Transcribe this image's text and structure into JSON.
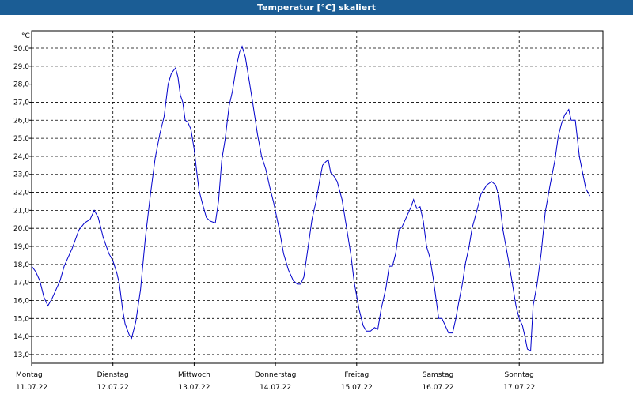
{
  "window": {
    "title": "Temperatur [°C] skaliert"
  },
  "chart_data": {
    "type": "line",
    "title": "Temperatur [°C] skaliert",
    "unit_label": "°C",
    "ylim": [
      12.5,
      31.0
    ],
    "yticks": [
      13.0,
      14.0,
      15.0,
      16.0,
      17.0,
      18.0,
      19.0,
      20.0,
      21.0,
      22.0,
      23.0,
      24.0,
      25.0,
      26.0,
      27.0,
      28.0,
      29.0,
      30.0
    ],
    "ytick_labels": [
      "13,0",
      "14,0",
      "15,0",
      "16,0",
      "17,0",
      "18,0",
      "19,0",
      "20,0",
      "21,0",
      "22,0",
      "23,0",
      "24,0",
      "25,0",
      "26,0",
      "27,0",
      "28,0",
      "29,0",
      "30,0"
    ],
    "days": [
      {
        "name": "Montag",
        "date": "11.07.22"
      },
      {
        "name": "Dienstag",
        "date": "12.07.22"
      },
      {
        "name": "Mittwoch",
        "date": "13.07.22"
      },
      {
        "name": "Donnerstag",
        "date": "14.07.22"
      },
      {
        "name": "Freitag",
        "date": "15.07.22"
      },
      {
        "name": "Samstag",
        "date": "16.07.22"
      },
      {
        "name": "Sonntag",
        "date": "17.07.22"
      }
    ],
    "x_unit": "day",
    "xlim": [
      0,
      7
    ],
    "grid": true,
    "line_color": "#0000cc",
    "series": [
      {
        "points": [
          [
            0.0,
            17.9
          ],
          [
            0.05,
            17.6
          ],
          [
            0.1,
            17.1
          ],
          [
            0.15,
            16.2
          ],
          [
            0.2,
            15.7
          ],
          [
            0.25,
            16.1
          ],
          [
            0.3,
            16.6
          ],
          [
            0.35,
            17.1
          ],
          [
            0.4,
            17.9
          ],
          [
            0.5,
            18.9
          ],
          [
            0.58,
            19.9
          ],
          [
            0.65,
            20.3
          ],
          [
            0.72,
            20.5
          ],
          [
            0.77,
            21.0
          ],
          [
            0.82,
            20.6
          ],
          [
            0.88,
            19.5
          ],
          [
            0.95,
            18.6
          ],
          [
            1.0,
            18.2
          ],
          [
            1.05,
            17.5
          ],
          [
            1.08,
            16.9
          ],
          [
            1.12,
            15.5
          ],
          [
            1.15,
            14.7
          ],
          [
            1.2,
            14.1
          ],
          [
            1.23,
            13.9
          ],
          [
            1.28,
            14.8
          ],
          [
            1.34,
            16.6
          ],
          [
            1.4,
            19.5
          ],
          [
            1.46,
            21.8
          ],
          [
            1.52,
            23.9
          ],
          [
            1.58,
            25.3
          ],
          [
            1.63,
            26.2
          ],
          [
            1.68,
            28.0
          ],
          [
            1.72,
            28.6
          ],
          [
            1.77,
            28.9
          ],
          [
            1.8,
            28.4
          ],
          [
            1.83,
            27.4
          ],
          [
            1.86,
            27.0
          ],
          [
            1.89,
            26.0
          ],
          [
            1.92,
            25.9
          ],
          [
            1.96,
            25.5
          ],
          [
            2.0,
            24.4
          ],
          [
            2.03,
            23.2
          ],
          [
            2.06,
            22.1
          ],
          [
            2.1,
            21.4
          ],
          [
            2.15,
            20.6
          ],
          [
            2.2,
            20.4
          ],
          [
            2.26,
            20.3
          ],
          [
            2.3,
            21.5
          ],
          [
            2.34,
            23.8
          ],
          [
            2.38,
            24.9
          ],
          [
            2.43,
            26.8
          ],
          [
            2.47,
            27.6
          ],
          [
            2.52,
            29.0
          ],
          [
            2.56,
            29.8
          ],
          [
            2.59,
            30.1
          ],
          [
            2.63,
            29.5
          ],
          [
            2.67,
            28.4
          ],
          [
            2.72,
            27.0
          ],
          [
            2.78,
            25.2
          ],
          [
            2.83,
            24.0
          ],
          [
            2.88,
            23.3
          ],
          [
            2.93,
            22.3
          ],
          [
            2.98,
            21.4
          ],
          [
            3.05,
            19.9
          ],
          [
            3.1,
            18.6
          ],
          [
            3.16,
            17.7
          ],
          [
            3.22,
            17.1
          ],
          [
            3.27,
            16.9
          ],
          [
            3.31,
            16.9
          ],
          [
            3.35,
            17.3
          ],
          [
            3.4,
            18.9
          ],
          [
            3.45,
            20.5
          ],
          [
            3.5,
            21.5
          ],
          [
            3.55,
            22.8
          ],
          [
            3.58,
            23.5
          ],
          [
            3.62,
            23.7
          ],
          [
            3.65,
            23.8
          ],
          [
            3.68,
            23.1
          ],
          [
            3.72,
            22.9
          ],
          [
            3.76,
            22.6
          ],
          [
            3.82,
            21.6
          ],
          [
            3.87,
            20.2
          ],
          [
            3.93,
            18.5
          ],
          [
            3.97,
            17.0
          ],
          [
            4.03,
            15.5
          ],
          [
            4.08,
            14.6
          ],
          [
            4.12,
            14.3
          ],
          [
            4.17,
            14.3
          ],
          [
            4.22,
            14.5
          ],
          [
            4.26,
            14.4
          ],
          [
            4.3,
            15.5
          ],
          [
            4.36,
            16.7
          ],
          [
            4.4,
            17.9
          ],
          [
            4.44,
            17.9
          ],
          [
            4.48,
            18.6
          ],
          [
            4.52,
            19.9
          ],
          [
            4.56,
            20.1
          ],
          [
            4.62,
            20.7
          ],
          [
            4.67,
            21.2
          ],
          [
            4.7,
            21.6
          ],
          [
            4.74,
            21.1
          ],
          [
            4.78,
            21.2
          ],
          [
            4.82,
            20.4
          ],
          [
            4.86,
            19.0
          ],
          [
            4.9,
            18.4
          ],
          [
            4.94,
            17.3
          ],
          [
            4.97,
            16.3
          ],
          [
            5.01,
            15.0
          ],
          [
            5.05,
            15.0
          ],
          [
            5.1,
            14.5
          ],
          [
            5.13,
            14.2
          ],
          [
            5.18,
            14.2
          ],
          [
            5.22,
            15.0
          ],
          [
            5.26,
            16.0
          ],
          [
            5.3,
            16.9
          ],
          [
            5.34,
            18.1
          ],
          [
            5.38,
            18.9
          ],
          [
            5.42,
            20.0
          ],
          [
            5.48,
            21.0
          ],
          [
            5.53,
            21.9
          ],
          [
            5.6,
            22.4
          ],
          [
            5.66,
            22.6
          ],
          [
            5.71,
            22.4
          ],
          [
            5.75,
            21.8
          ],
          [
            5.8,
            19.9
          ],
          [
            5.84,
            18.9
          ],
          [
            5.88,
            17.9
          ],
          [
            5.92,
            16.8
          ],
          [
            5.96,
            15.7
          ],
          [
            6.0,
            15.0
          ],
          [
            6.04,
            14.6
          ],
          [
            6.07,
            14.0
          ],
          [
            6.1,
            13.3
          ],
          [
            6.14,
            13.2
          ],
          [
            6.17,
            15.7
          ],
          [
            6.22,
            16.9
          ],
          [
            6.27,
            18.6
          ],
          [
            6.32,
            20.9
          ],
          [
            6.38,
            22.4
          ],
          [
            6.44,
            23.8
          ],
          [
            6.48,
            25.1
          ],
          [
            6.52,
            25.8
          ],
          [
            6.56,
            26.3
          ],
          [
            6.61,
            26.6
          ],
          [
            6.64,
            26.0
          ],
          [
            6.69,
            26.0
          ],
          [
            6.74,
            24.0
          ],
          [
            6.78,
            23.1
          ],
          [
            6.82,
            22.2
          ],
          [
            6.87,
            21.8
          ]
        ]
      }
    ]
  }
}
